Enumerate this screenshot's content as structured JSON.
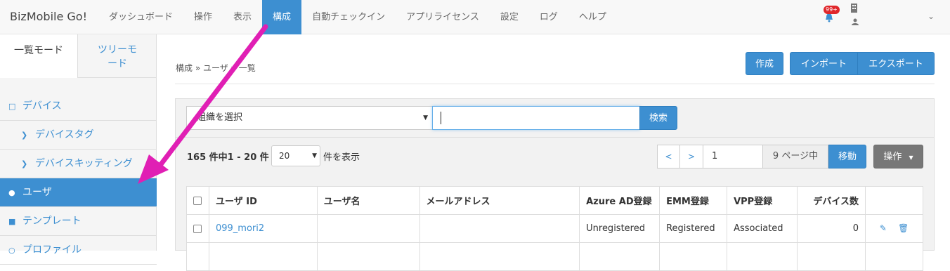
{
  "brand": "BizMobile Go!",
  "nav": [
    "ダッシュボード",
    "操作",
    "表示",
    "構成",
    "自動チェックイン",
    "アプリライセンス",
    "設定",
    "ログ",
    "ヘルプ"
  ],
  "nav_active_index": 3,
  "notifications_badge": "99+",
  "sidebar": {
    "tabs": [
      "一覧モード",
      "ツリーモード"
    ],
    "items": [
      {
        "label": "デバイス",
        "icon": "square-icon"
      },
      {
        "label": "デバイスタグ",
        "icon": "chevron-right-icon"
      },
      {
        "label": "デバイスキッティング",
        "icon": "chevron-right-icon"
      },
      {
        "label": "ユーザ",
        "icon": "user-icon"
      },
      {
        "label": "テンプレート",
        "icon": "file-icon"
      },
      {
        "label": "プロファイル",
        "icon": "circle-icon"
      }
    ]
  },
  "breadcrumb": "構成 » ユーザ » 一覧",
  "buttons": {
    "create": "作成",
    "import": "インポート",
    "export": "エクスポート",
    "search": "検索",
    "move": "移動",
    "operations": "操作"
  },
  "filter": {
    "org_select": "組織を選択",
    "search_value": ""
  },
  "summary": "165 件中1 - 20 件",
  "per_page": "20",
  "per_page_label": "件を表示",
  "pagination": {
    "prev": "<",
    "next": ">",
    "page": "1",
    "total": "9 ページ中"
  },
  "table": {
    "headers": [
      "ユーザ ID",
      "ユーザ名",
      "メールアドレス",
      "Azure AD登録",
      "EMM登録",
      "VPP登録",
      "デバイス数"
    ],
    "rows": [
      {
        "user_id": "099_mori2",
        "user_name": "",
        "email": "",
        "azure": "Unregistered",
        "emm": "Registered",
        "vpp": "Associated",
        "devices": "0"
      }
    ]
  },
  "colors": {
    "accent": "#3d8fd1",
    "arrow": "#e01fb4",
    "badge": "#e0262a"
  }
}
